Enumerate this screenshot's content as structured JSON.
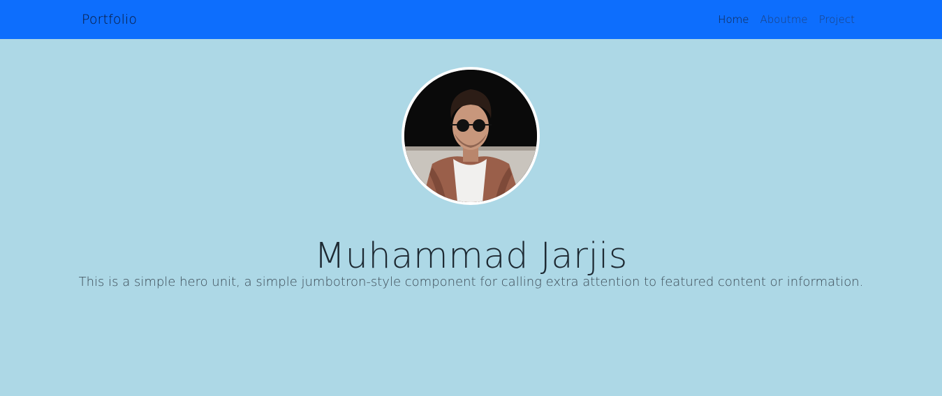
{
  "navbar": {
    "brand": "Portfolio",
    "links": [
      {
        "label": "Home",
        "active": true
      },
      {
        "label": "Aboutme",
        "active": false
      },
      {
        "label": "Project",
        "active": false
      }
    ]
  },
  "hero": {
    "avatar_alt": "profile photo of man with sunglasses",
    "title": "Muhammad Jarjis",
    "lead": "This is a simple hero unit, a simple jumbotron-style component for calling extra attention to featured content or information."
  },
  "colors": {
    "navbar_bg": "#0d6efd",
    "page_bg": "#add8e6"
  }
}
